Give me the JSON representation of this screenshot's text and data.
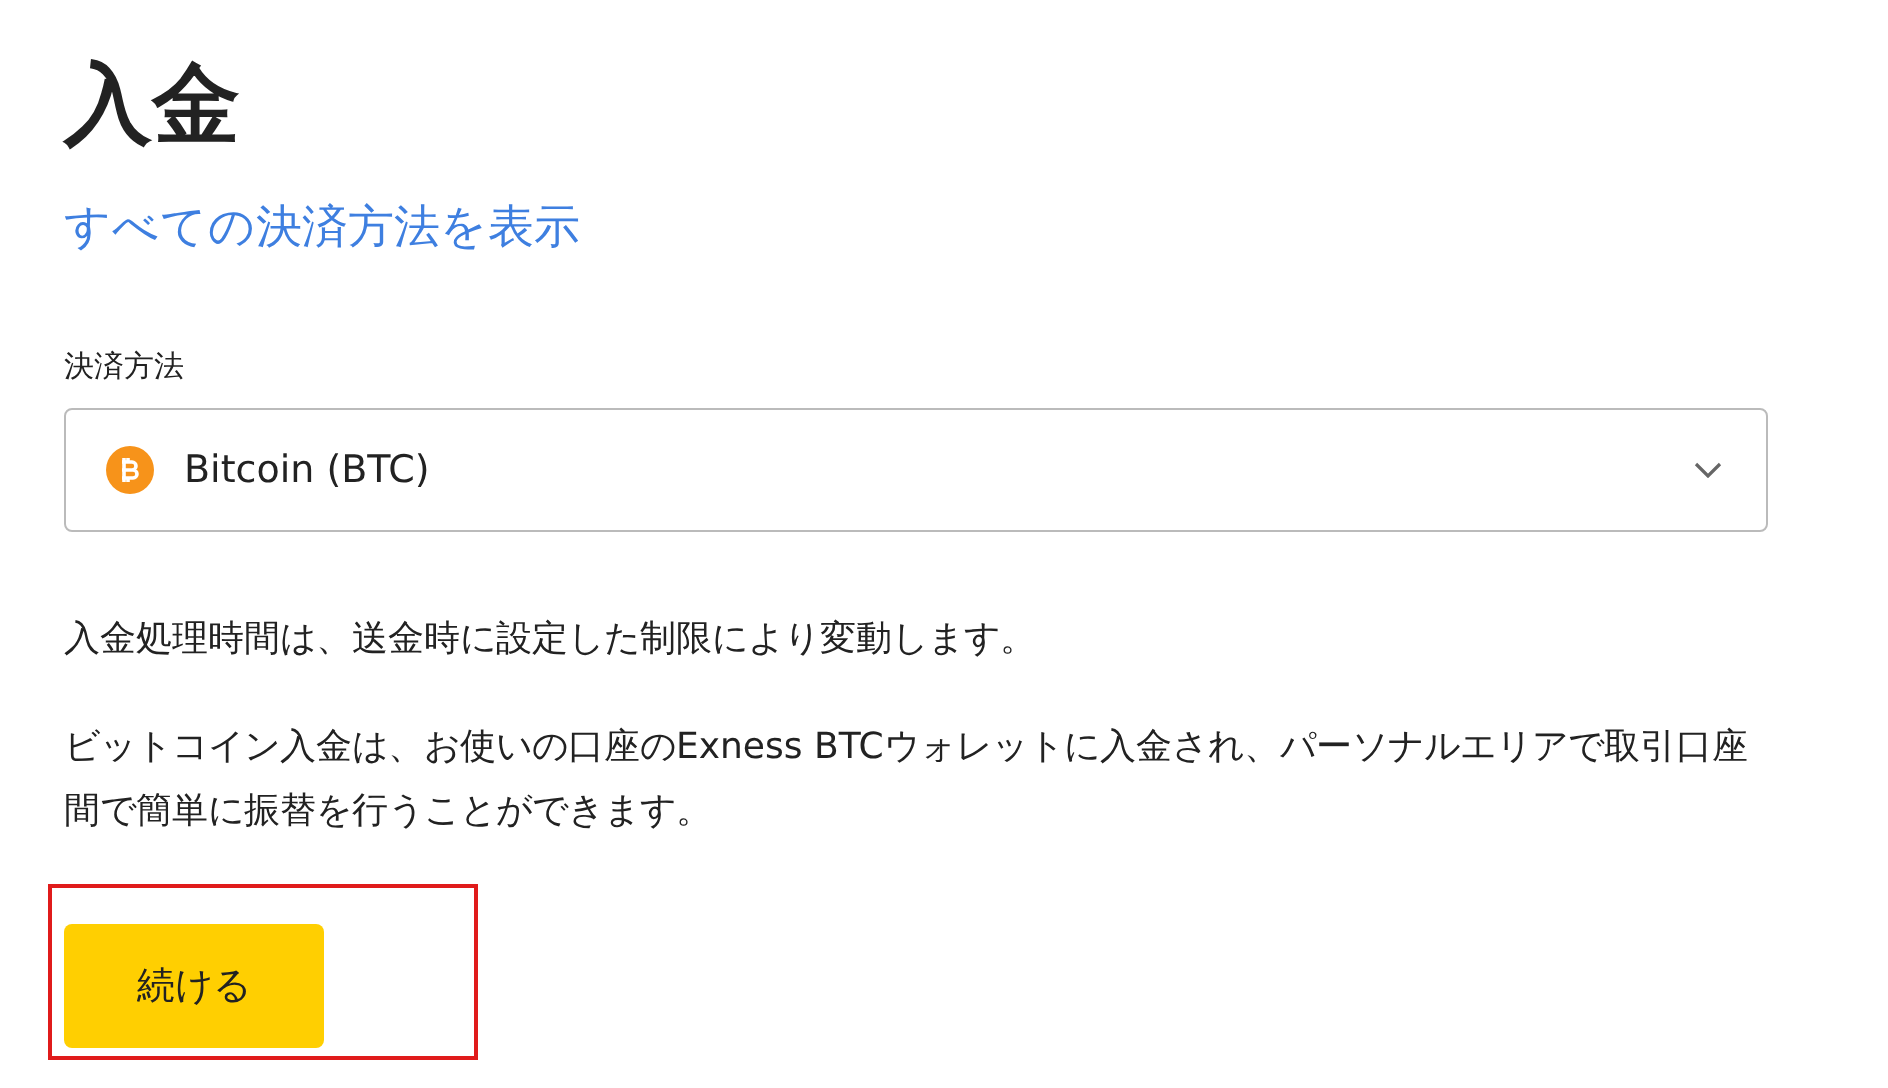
{
  "title": "入金",
  "all_methods_link": "すべての決済方法を表示",
  "payment_method": {
    "label": "決済方法",
    "value": "Bitcoin (BTC)"
  },
  "notes": [
    "入金処理時間は、送金時に設定した制限により変動します。",
    "ビットコイン入金は、お使いの口座のExness BTCウォレットに入金され、パーソナルエリアで取引口座間で簡単に振替を行うことができます。"
  ],
  "continue_button": {
    "label": "続ける",
    "highlighted": true
  }
}
